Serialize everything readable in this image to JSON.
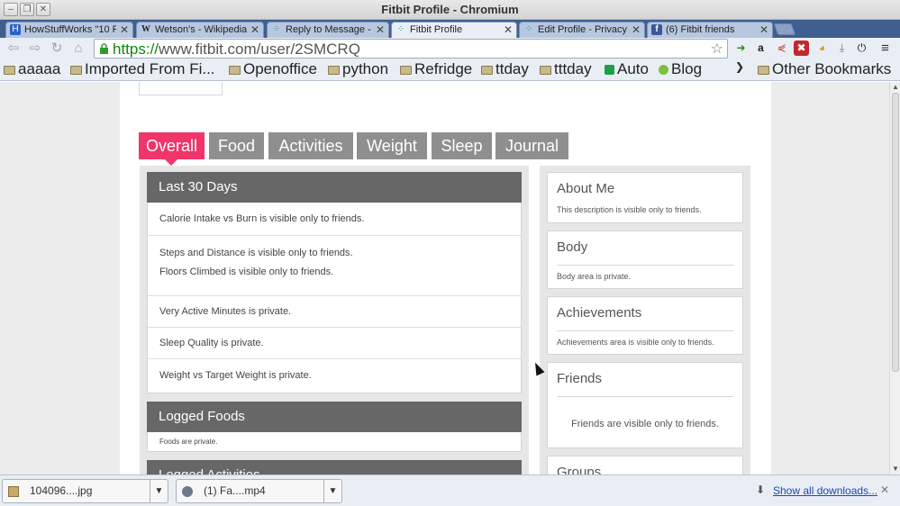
{
  "window": {
    "title": "Fitbit Profile - Chromium",
    "minimize": "–",
    "restore": "❐",
    "close": "✕"
  },
  "tabs": [
    {
      "label": "HowStuffWorks \"10 Rea",
      "icon": "howstuffworks-icon"
    },
    {
      "label": "Wetson's - Wikipedia, th",
      "icon": "wikipedia-icon"
    },
    {
      "label": "Reply to Message - Fitbit",
      "icon": "fitbit-icon"
    },
    {
      "label": "Fitbit Profile",
      "icon": "fitbit-icon"
    },
    {
      "label": "Edit Profile - Privacy Se",
      "icon": "fitbit-icon"
    },
    {
      "label": "(6) Fitbit friends",
      "icon": "facebook-icon"
    }
  ],
  "toolbar": {
    "url_scheme": "https://",
    "url_rest": "www.fitbit.com/user/2SMCRQ"
  },
  "bookmarks": [
    {
      "label": "aaaaa",
      "icon": "folder-icon"
    },
    {
      "label": "Imported From Fi...",
      "icon": "folder-icon"
    },
    {
      "label": "Openoffice",
      "icon": "folder-icon"
    },
    {
      "label": "python",
      "icon": "folder-icon"
    },
    {
      "label": "Refridge",
      "icon": "folder-icon"
    },
    {
      "label": "ttday",
      "icon": "folder-icon"
    },
    {
      "label": "tttday",
      "icon": "folder-icon"
    },
    {
      "label": "Auto",
      "icon": "sheets-icon"
    },
    {
      "label": "Blog",
      "icon": "blog-icon"
    },
    {
      "label": "Other Bookmarks",
      "icon": "folder-icon"
    }
  ],
  "profile_tabs": [
    "Overall",
    "Food",
    "Activities",
    "Weight",
    "Sleep",
    "Journal"
  ],
  "left": {
    "last30": {
      "title": "Last 30 Days",
      "rows": [
        "Calorie Intake vs Burn is visible only to friends.",
        "Steps and Distance is visible only to friends.",
        "Floors Climbed is visible only to friends.",
        "Very Active Minutes is private.",
        "Sleep Quality is private.",
        "Weight vs Target Weight is private."
      ]
    },
    "foods": {
      "title": "Logged Foods",
      "text": "Foods are private."
    },
    "activities": {
      "title": "Logged Activities"
    }
  },
  "right": {
    "about": {
      "title": "About Me",
      "text": "This description is visible only to friends."
    },
    "body": {
      "title": "Body",
      "text": "Body area is private."
    },
    "achievements": {
      "title": "Achievements",
      "text": "Achievements area is visible only to friends."
    },
    "friends": {
      "title": "Friends",
      "text": "Friends are visible only to friends."
    },
    "groups": {
      "title": "Groups"
    }
  },
  "downloads": {
    "items": [
      {
        "label": "104096....jpg",
        "icon": "image-file-icon"
      },
      {
        "label": "(1) Fa....mp4",
        "icon": "video-file-icon"
      }
    ],
    "show_all": "Show all downloads..."
  }
}
